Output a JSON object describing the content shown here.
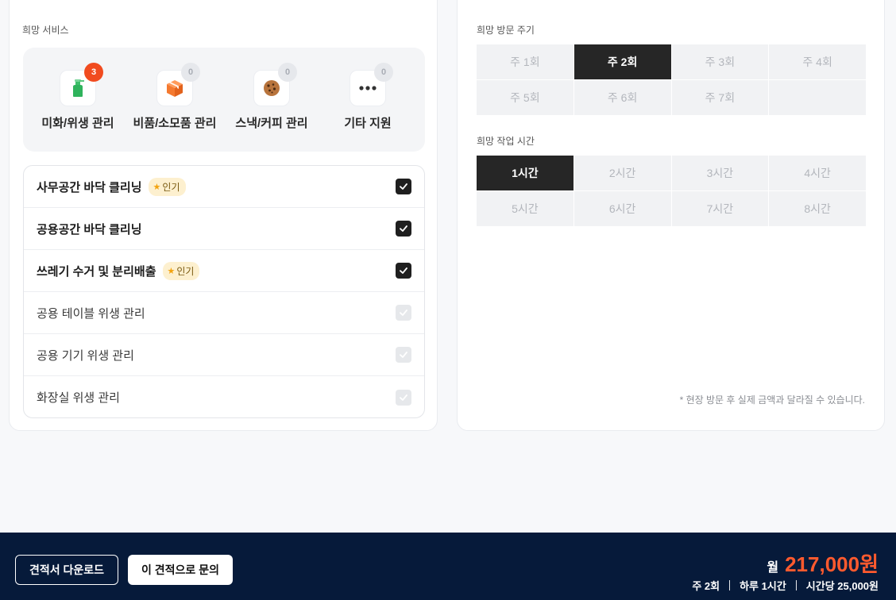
{
  "left_panel": {
    "section_label": "희망 서비스",
    "categories": [
      {
        "label": "미화/위생 관리",
        "count": "3",
        "icon": "spray-bottle-icon"
      },
      {
        "label": "비품/소모품 관리",
        "count": "0",
        "icon": "package-box-icon"
      },
      {
        "label": "스낵/커피 관리",
        "count": "0",
        "icon": "cookie-icon"
      },
      {
        "label": "기타 지원",
        "count": "0",
        "icon": "more-dots-icon"
      }
    ],
    "services": [
      {
        "name": "사무공간 바닥 클리닝",
        "badge": "인기",
        "checked": true
      },
      {
        "name": "공용공간 바닥 클리닝",
        "badge": "",
        "checked": true
      },
      {
        "name": "쓰레기 수거 및 분리배출",
        "badge": "인기",
        "checked": true
      },
      {
        "name": "공용 테이블 위생 관리",
        "badge": "",
        "checked": false
      },
      {
        "name": "공용 기기 위생 관리",
        "badge": "",
        "checked": false
      },
      {
        "name": "화장실 위생 관리",
        "badge": "",
        "checked": false
      }
    ]
  },
  "right_panel": {
    "frequency_label": "희망 방문 주기",
    "frequency_options": [
      "주 1회",
      "주 2회",
      "주 3회",
      "주 4회",
      "주 5회",
      "주 6회",
      "주 7회",
      ""
    ],
    "frequency_selected": "주 2회",
    "hours_label": "희망 작업 시간",
    "hours_options": [
      "1시간",
      "2시간",
      "3시간",
      "4시간",
      "5시간",
      "6시간",
      "7시간",
      "8시간"
    ],
    "hours_selected": "1시간",
    "note": "* 현장 방문 후 실제 금액과 달라질 수 있습니다."
  },
  "footer": {
    "download_label": "견적서 다운로드",
    "inquiry_label": "이 견적으로 문의",
    "price_prefix": "월",
    "price_value": "217,000원",
    "summary_frequency": "주 2회",
    "summary_daily": "하루 1시간",
    "summary_rate": "시간당 25,000원"
  },
  "colors": {
    "accent": "#f14b1f",
    "price": "#ff5a2e",
    "footer_bg": "#061a3a",
    "selected_cell": "#262626"
  }
}
